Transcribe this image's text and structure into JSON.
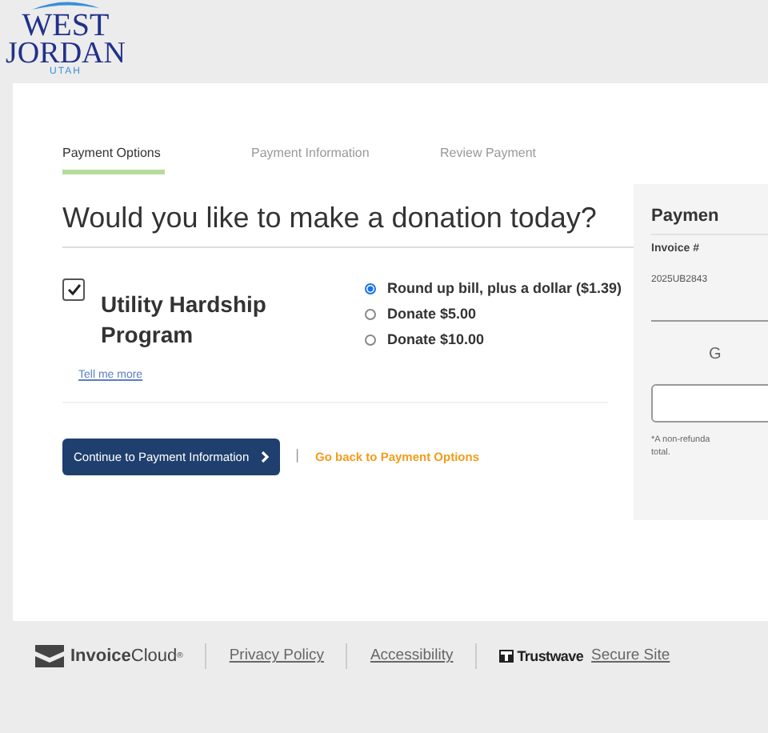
{
  "logo": {
    "line_1": "WEST",
    "line_2": "JORDAN",
    "line_3": "UTAH"
  },
  "steps": [
    {
      "label": "Payment Options",
      "selected": true
    },
    {
      "label": "Payment Information",
      "selected": false
    },
    {
      "label": "Review Payment",
      "selected": false
    }
  ],
  "heading": "Would you like to make a donation today?",
  "program": {
    "name": "Utility Hardship Program",
    "checked": true,
    "link": "Tell me more"
  },
  "options": [
    {
      "label": "Round up bill, plus a dollar ($1.39)",
      "selected": true
    },
    {
      "label": "Donate $5.00",
      "selected": false
    },
    {
      "label": "Donate $10.00",
      "selected": false
    }
  ],
  "continue_button": "Continue to Payment Information",
  "separator": "|",
  "back_link": "Go back to Payment Options",
  "summary": {
    "title": "Paymen",
    "invoice_label": "Invoice #",
    "invoice_value": "2025UB2843",
    "cut_label": "G",
    "note_lines": [
      "*A non-refunda",
      "total."
    ]
  },
  "footer": {
    "brand_bold": "Invoice",
    "brand_light": "Cloud",
    "brand_mark": "®",
    "links": [
      "Privacy Policy",
      "Accessibility"
    ],
    "trust_brand": "Trustwave",
    "trust_link": "Secure Site"
  }
}
